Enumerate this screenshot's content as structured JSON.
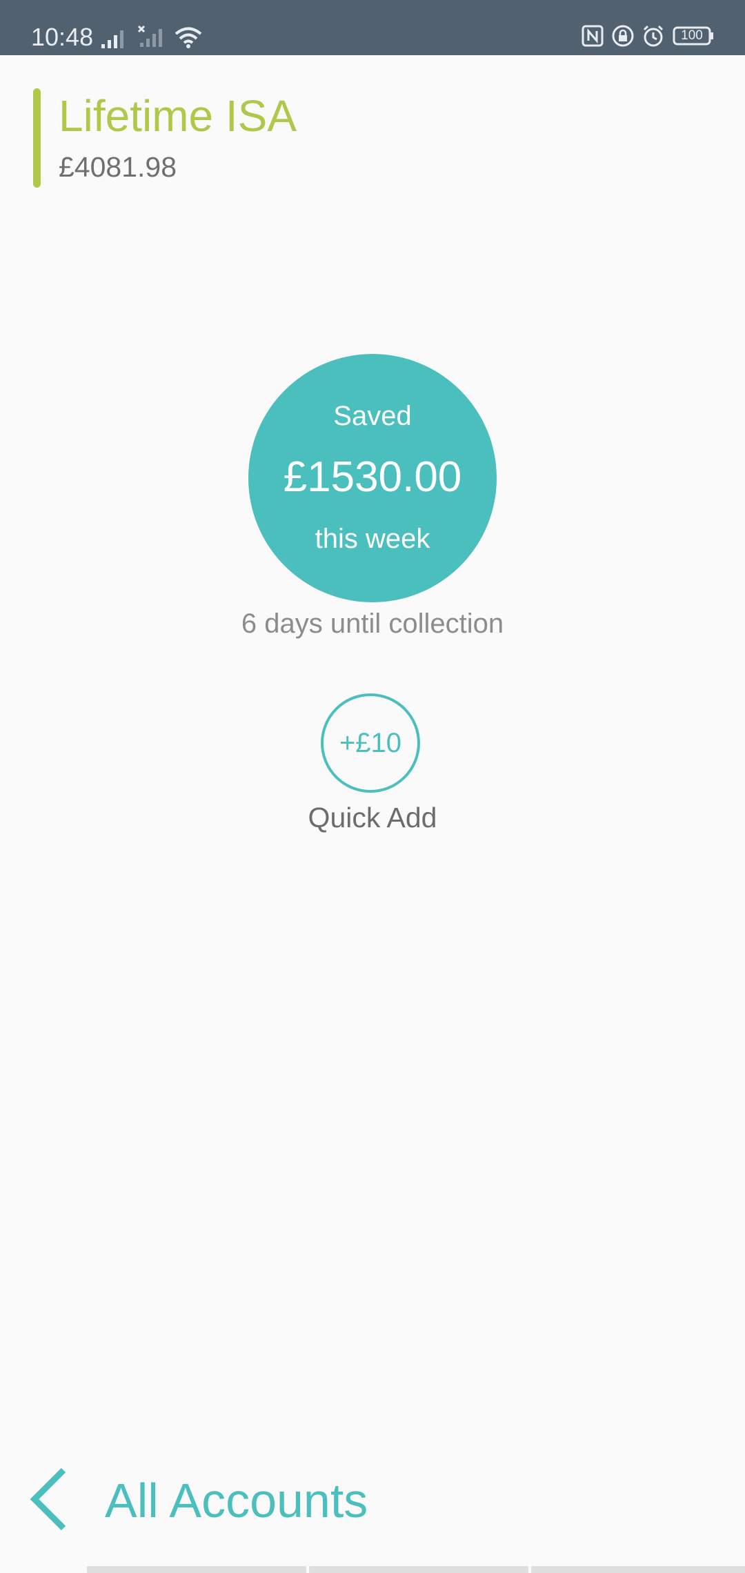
{
  "status_bar": {
    "time": "10:48",
    "battery": "100",
    "left_icons": [
      "signal-icon",
      "no-signal-icon",
      "wifi-icon"
    ],
    "right_icons": [
      "nfc-icon",
      "lock-icon",
      "alarm-icon",
      "battery-icon"
    ],
    "background_color": "#526170"
  },
  "account": {
    "name": "Lifetime ISA",
    "balance": "£4081.98",
    "accent_color": "#aec94a"
  },
  "savings": {
    "label": "Saved",
    "amount": "£1530.00",
    "period": "this week",
    "collection_text": "6 days until collection",
    "circle_color": "#4abfbd"
  },
  "quick_add": {
    "button_label": "+£10",
    "caption": "Quick Add"
  },
  "navigation": {
    "back_label": "All Accounts",
    "back_icon": "chevron-left-icon",
    "page_count": 3
  }
}
